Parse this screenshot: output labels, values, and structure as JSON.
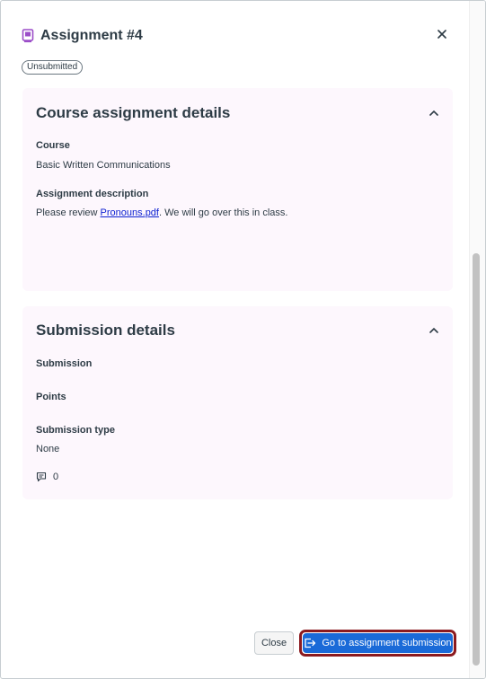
{
  "header": {
    "title": "Assignment #4",
    "icon": "assignment-icon",
    "close_icon": "close-icon"
  },
  "status_badge": "Unsubmitted",
  "course_details": {
    "title": "Course assignment details",
    "course_label": "Course",
    "course_value": "Basic Written Communications",
    "description_label": "Assignment description",
    "description_prefix": "Please review ",
    "description_link": "Pronouns.pdf",
    "description_suffix": ". We will go over this in class."
  },
  "submission_details": {
    "title": "Submission details",
    "submission_label": "Submission",
    "points_label": "Points",
    "type_label": "Submission type",
    "type_value": "None",
    "comment_count": "0"
  },
  "footer": {
    "close_label": "Close",
    "go_label": "Go to assignment submission"
  },
  "colors": {
    "accent": "#1a6ad8",
    "focus_ring": "#8b1a1f",
    "card_bg": "#fdf7fd",
    "icon_purple": "#9b4dc8"
  }
}
